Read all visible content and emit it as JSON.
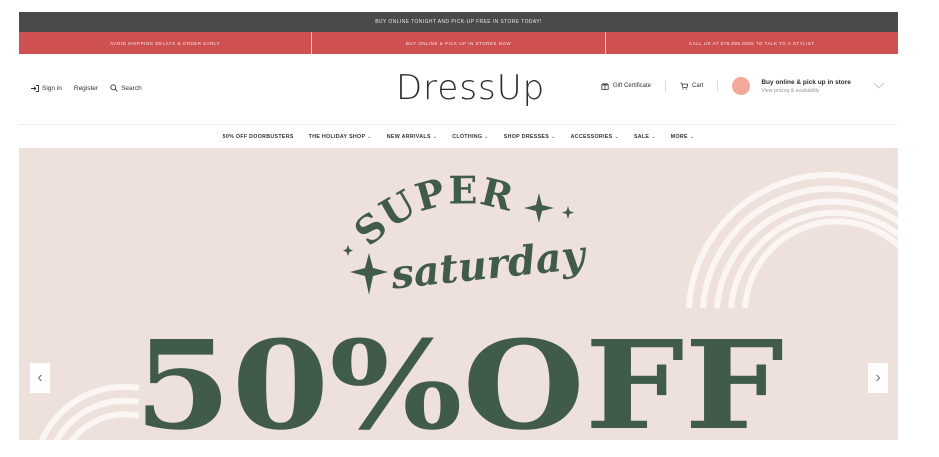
{
  "topbar": {
    "text": "Buy online tonight and pick-up free in store today!"
  },
  "promos": [
    {
      "text": "Avoid shipping delays & order early"
    },
    {
      "text": "Buy online & pick up in stores now"
    },
    {
      "text": "Call us at 678.999.0006 to talk to a stylist"
    }
  ],
  "header": {
    "sign_in": "Sign in",
    "register": "Register",
    "search": "Search",
    "logo": "DressUp",
    "gift_certificate": "Gift Certificate",
    "cart": "Cart",
    "store_title": "Buy online & pick up in store",
    "store_sub": "View pricing & availability"
  },
  "nav": [
    {
      "label": "50% Off Doorbusters",
      "chevron": ""
    },
    {
      "label": "The Holiday Shop",
      "chevron": "⌄"
    },
    {
      "label": "New Arrivals",
      "chevron": "⌄"
    },
    {
      "label": "Clothing",
      "chevron": "⌄"
    },
    {
      "label": "Shop Dresses",
      "chevron": "⌄"
    },
    {
      "label": "Accessories",
      "chevron": "⌄"
    },
    {
      "label": "Sale",
      "chevron": "⌄"
    },
    {
      "label": "More",
      "chevron": "⌄"
    }
  ],
  "hero": {
    "super": "SUPER",
    "saturday": "saturday",
    "headline": "50%OFF",
    "prev": "‹",
    "next": "›"
  },
  "colors": {
    "topbar": "#4a4a4a",
    "promobar": "#cf5050",
    "hero_bg": "#eee1dc",
    "hero_green": "#415b4b",
    "arch": "#fbf6f3"
  }
}
